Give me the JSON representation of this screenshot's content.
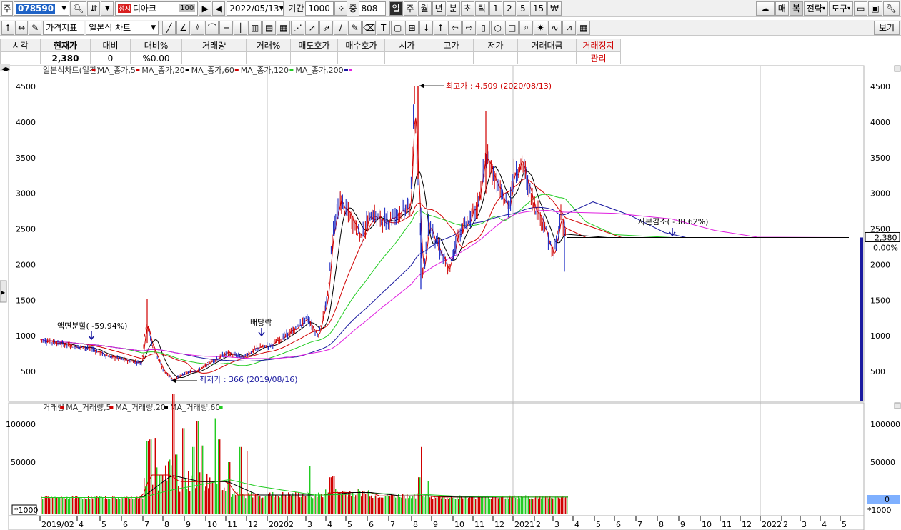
{
  "toolbar": {
    "market_label": "주",
    "code": "078590",
    "status_tag": "정지",
    "stock_name": "디아크",
    "name_suffix": "100",
    "date": "2022/05/13",
    "period_label": "기간",
    "period_value": "1000",
    "count_label": "중",
    "count_value": "808",
    "timeframes": [
      "일",
      "주",
      "월",
      "년",
      "분",
      "초",
      "틱",
      "1",
      "2",
      "5",
      "15",
      "₩"
    ],
    "selected_timeframe": "일",
    "right_buttons": [
      "매",
      "복",
      "전략",
      "도구"
    ],
    "indicator_button": "가격지표",
    "chart_type": "일본식 차트",
    "view_button": "보기"
  },
  "quote": {
    "headers": [
      "시각",
      "현재가",
      "대비",
      "대비%",
      "거래량",
      "거래%",
      "매도호가",
      "매수호가",
      "시가",
      "고가",
      "저가",
      "거래대금",
      "거래정지"
    ],
    "values": [
      "",
      "2,380",
      "0",
      "%0.00",
      "",
      "",
      "",
      "",
      "",
      "",
      "",
      "",
      "관리"
    ]
  },
  "price_panel": {
    "legend": [
      {
        "text": "일본식차트(일간)",
        "color": "#d00000"
      },
      {
        "text": "MA_종가,5",
        "color": "#d00000"
      },
      {
        "text": "MA_종가,20",
        "color": "#000000"
      },
      {
        "text": "MA_종가,60",
        "color": "#d00000"
      },
      {
        "text": "MA_종가,120",
        "color": "#22cc22"
      },
      {
        "text": "MA_종가,200",
        "color": "#1a1aa0"
      }
    ],
    "legend_tail_color": "#e020e0",
    "y_ticks": [
      "4500",
      "4000",
      "3500",
      "3000",
      "2500",
      "2000",
      "1500",
      "1000",
      "500"
    ],
    "current_price": "2,380",
    "current_change": "0.00%",
    "annotations": {
      "high": "최고가 : 4,509 (2020/08/13)",
      "low": "최저가 : 366 (2019/08/16)",
      "split": "액면분할( -59.94%)",
      "dividend": "배당락",
      "capital_reduction": "자본감소( -38.62%)"
    }
  },
  "volume_panel": {
    "legend": [
      {
        "text": "거래량",
        "color": "#d00000"
      },
      {
        "text": "MA_거래량,5",
        "color": "#d00000"
      },
      {
        "text": "MA_거래량,20",
        "color": "#000000"
      },
      {
        "text": "MA_거래량,60",
        "color": "#22cc22"
      }
    ],
    "y_ticks": [
      "100000",
      "50000"
    ],
    "unit": "*1000",
    "current_volume": "0"
  },
  "x_axis": [
    "2019/02",
    "4",
    "5",
    "6",
    "7",
    "8",
    "9",
    "10",
    "11",
    "12",
    "2020",
    "2",
    "3",
    "4",
    "5",
    "6",
    "7",
    "8",
    "9",
    "10",
    "11",
    "12",
    "2021",
    "2",
    "3",
    "4",
    "5",
    "6",
    "7",
    "8",
    "9",
    "10",
    "11",
    "12",
    "2022",
    "2",
    "3",
    "4",
    "5"
  ],
  "colors": {
    "up": "#d00000",
    "down": "#1020c0",
    "ma5": "#d00000",
    "ma20": "#000000",
    "ma60": "#d00000",
    "ma120": "#22cc22",
    "ma200": "#1a1aa0",
    "ma_extra": "#e020e0",
    "volume_up": "#d00000",
    "volume_green": "#22cc22"
  }
}
